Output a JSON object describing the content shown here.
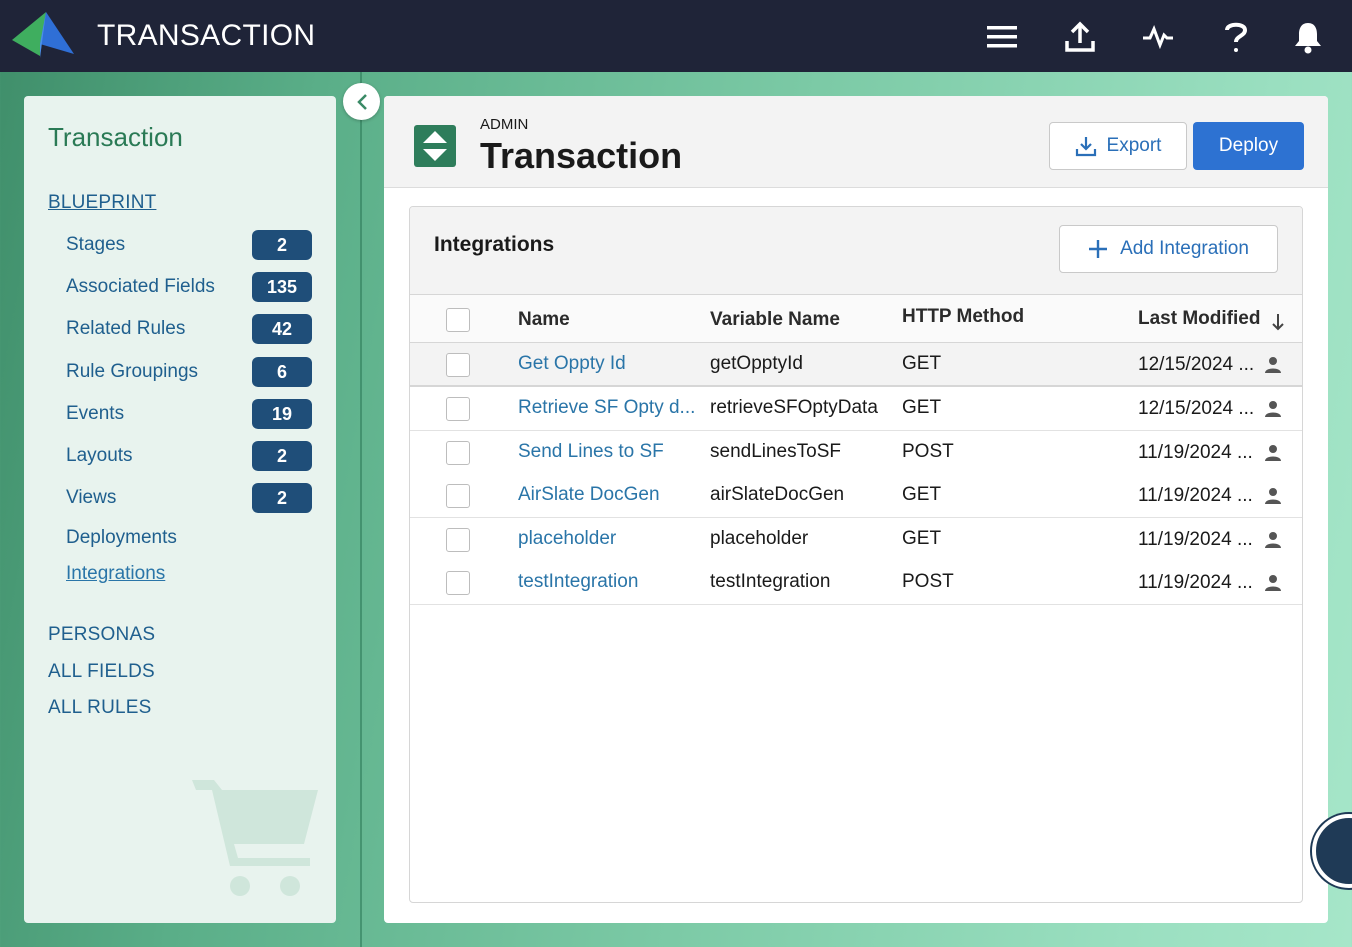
{
  "app": {
    "title": "TRANSACTION"
  },
  "topbar": {
    "icons": [
      "menu-icon",
      "upload-icon",
      "activity-icon",
      "help-icon",
      "bell-icon"
    ]
  },
  "sidebar": {
    "title": "Transaction",
    "blueprint_label": "BLUEPRINT",
    "items": [
      {
        "label": "Stages",
        "count": "2"
      },
      {
        "label": "Associated Fields",
        "count": "135"
      },
      {
        "label": "Related Rules",
        "count": "42"
      },
      {
        "label": "Rule Groupings",
        "count": "6"
      },
      {
        "label": "Events",
        "count": "19"
      },
      {
        "label": "Layouts",
        "count": "2"
      },
      {
        "label": "Views",
        "count": "2"
      }
    ],
    "deployments_label": "Deployments",
    "integrations_label": "Integrations",
    "sections": [
      "PERSONAS",
      "ALL FIELDS",
      "ALL RULES"
    ]
  },
  "header": {
    "eyebrow": "ADMIN",
    "title": "Transaction",
    "export_label": "Export",
    "deploy_label": "Deploy"
  },
  "integrations": {
    "title": "Integrations",
    "add_label": "Add Integration",
    "columns": [
      "Name",
      "Variable Name",
      "HTTP Method",
      "Last Modified"
    ],
    "rows": [
      {
        "name": "Get Oppty Id",
        "variable": "getOpptyId",
        "method": "GET",
        "modified": "12/15/2024 ..."
      },
      {
        "name": "Retrieve SF Opty d...",
        "variable": "retrieveSFOptyData",
        "method": "GET",
        "modified": "12/15/2024 ..."
      },
      {
        "name": "Send Lines to SF",
        "variable": "sendLinesToSF",
        "method": "POST",
        "modified": "11/19/2024 ..."
      },
      {
        "name": "AirSlate DocGen",
        "variable": "airSlateDocGen",
        "method": "GET",
        "modified": "11/19/2024 ..."
      },
      {
        "name": "placeholder",
        "variable": "placeholder",
        "method": "GET",
        "modified": "11/19/2024 ..."
      },
      {
        "name": "testIntegration",
        "variable": "testIntegration",
        "method": "POST",
        "modified": "11/19/2024 ..."
      }
    ]
  },
  "colors": {
    "topbar": "#1f2438",
    "accent_blue": "#2d72d2",
    "badge": "#1f4e79",
    "link": "#2a75a8",
    "sidebar_title": "#2a7a55"
  }
}
